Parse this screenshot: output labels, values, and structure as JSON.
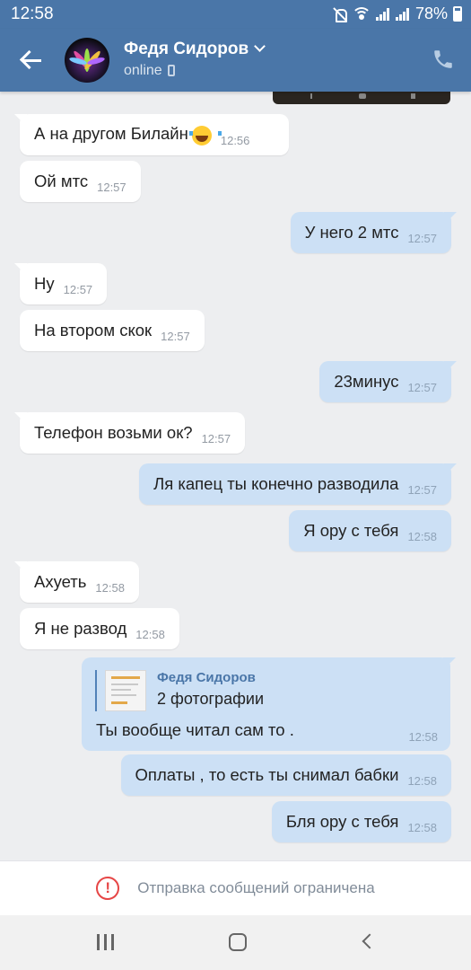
{
  "status_bar": {
    "time": "12:58",
    "battery": "78%",
    "icons": [
      "mute-icon",
      "wifi-icon",
      "signal-icon",
      "signal-icon"
    ]
  },
  "header": {
    "contact_name": "Федя Сидоров",
    "status": "online",
    "back_icon": "arrow-left-icon",
    "call_icon": "phone-icon",
    "accent_color": "#4a76a8"
  },
  "messages": [
    {
      "dir": "in",
      "text": "А на другом Билайн",
      "emoji": "tears-of-joy",
      "time": "12:56"
    },
    {
      "dir": "in",
      "text": "Ой мтс",
      "time": "12:57"
    },
    {
      "dir": "out",
      "text": "У него 2 мтс",
      "time": "12:57"
    },
    {
      "dir": "in",
      "text": "Ну",
      "time": "12:57"
    },
    {
      "dir": "in",
      "text": "На втором скок",
      "time": "12:57"
    },
    {
      "dir": "out",
      "text": "23минус",
      "time": "12:57"
    },
    {
      "dir": "in",
      "text": "Телефон возьми ок?",
      "time": "12:57"
    },
    {
      "dir": "out",
      "text": "Ля капец ты конечно разводила",
      "time": "12:57"
    },
    {
      "dir": "out",
      "text": "Я ору с тебя",
      "time": "12:58"
    },
    {
      "dir": "in",
      "text": "Ахуеть",
      "time": "12:58"
    },
    {
      "dir": "in",
      "text": "Я не развод",
      "time": "12:58"
    }
  ],
  "forwarded": {
    "author": "Федя Сидоров",
    "attachment": "2 фотографии",
    "text": "Ты вообще читал сам то .",
    "time": "12:58"
  },
  "after_messages": [
    {
      "dir": "out",
      "text": "Оплаты , то есть ты снимал бабки",
      "time": "12:58"
    },
    {
      "dir": "out",
      "text": "Бля ору с тебя",
      "time": "12:58"
    }
  ],
  "restriction": {
    "icon": "exclamation-circle-icon",
    "text": "Отправка сообщений ограничена"
  },
  "nav_bar": {
    "icons": [
      "recents-icon",
      "home-icon",
      "back-icon"
    ]
  }
}
